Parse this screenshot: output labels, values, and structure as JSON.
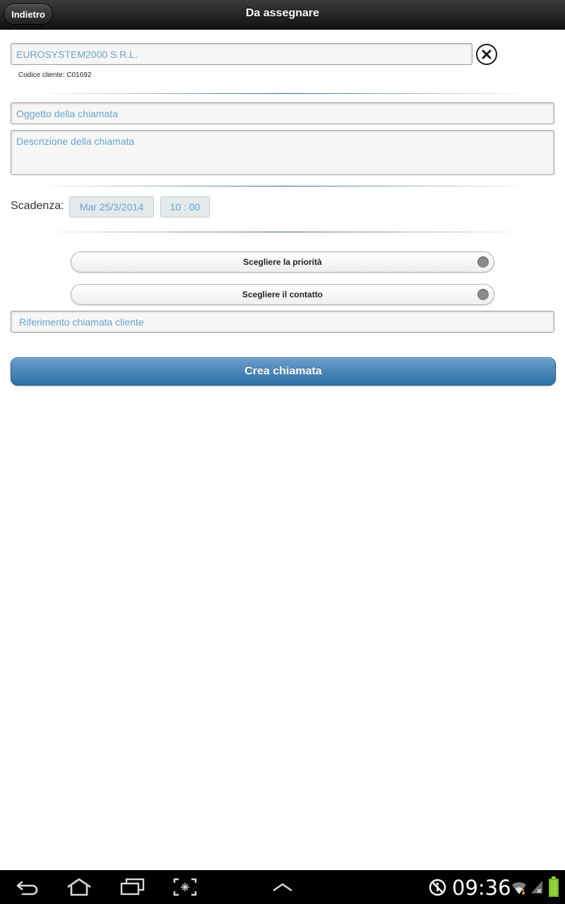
{
  "header": {
    "title": "Da assegnare",
    "back_label": "Indietro"
  },
  "form": {
    "cliente_value": "EUROSYSTEM2000 S.R.L.",
    "codice_cliente": "Codice cliente: C01692",
    "oggetto_placeholder": "Oggetto della chiamata",
    "descrizione_placeholder": "Descrizione della chiamata",
    "scadenza_label": "Scadenza:",
    "scadenza_date": "Mar 25/3/2014",
    "scadenza_time": "10 : 00",
    "priority_label": "Scegliere la priorità",
    "contact_label": "Scegliere il contatto",
    "riferimento_placeholder": "Riferimento chiamata cliente",
    "submit_label": "Crea chiamata"
  },
  "system_bar": {
    "time": "09:36",
    "icons": [
      "back-icon",
      "home-icon",
      "recent-apps-icon",
      "screenshot-icon",
      "chevron-up-icon",
      "accessibility-icon",
      "wifi-icon",
      "signal-icon",
      "battery-icon"
    ]
  },
  "colors": {
    "accent": "#3d7cb2",
    "input_text": "#6ba3c8",
    "header_bg": "#1e1e1e"
  }
}
